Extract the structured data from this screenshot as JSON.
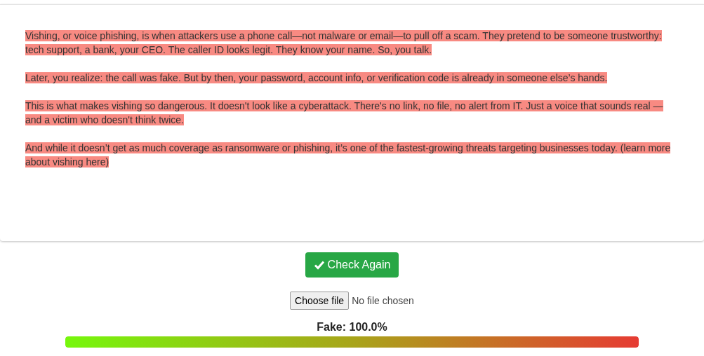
{
  "paragraphs": [
    {
      "text": "Vishing, or voice phishing, is when attackers use a phone call—not malware or email—to pull off a scam. They pretend to be someone trustworthy: tech support, a bank, your CEO. The caller ID looks legit. They know your name. So, you talk.",
      "highlighted": true
    },
    {
      "text": "Later, you realize: the call was fake. But by then, your password, account info, or verification code is already in someone else’s hands.",
      "highlighted": true
    },
    {
      "text": "This is what makes vishing so dangerous. It doesn't look like a cyberattack. There's no link, no file, no alert from IT. Just a voice that sounds real — and a victim who doesn't think twice.",
      "highlighted": true
    },
    {
      "text": "And while it doesn’t get as much coverage as ransomware or phishing, it’s one of the fastest-growing threats targeting businesses today. (learn more about vishing here)",
      "highlighted": true
    }
  ],
  "check_button": {
    "label": "Check Again"
  },
  "file_input": {
    "button": "Choose file",
    "status": "No file chosen"
  },
  "result": {
    "label": "Fake: 100.0%",
    "level": 1
  }
}
